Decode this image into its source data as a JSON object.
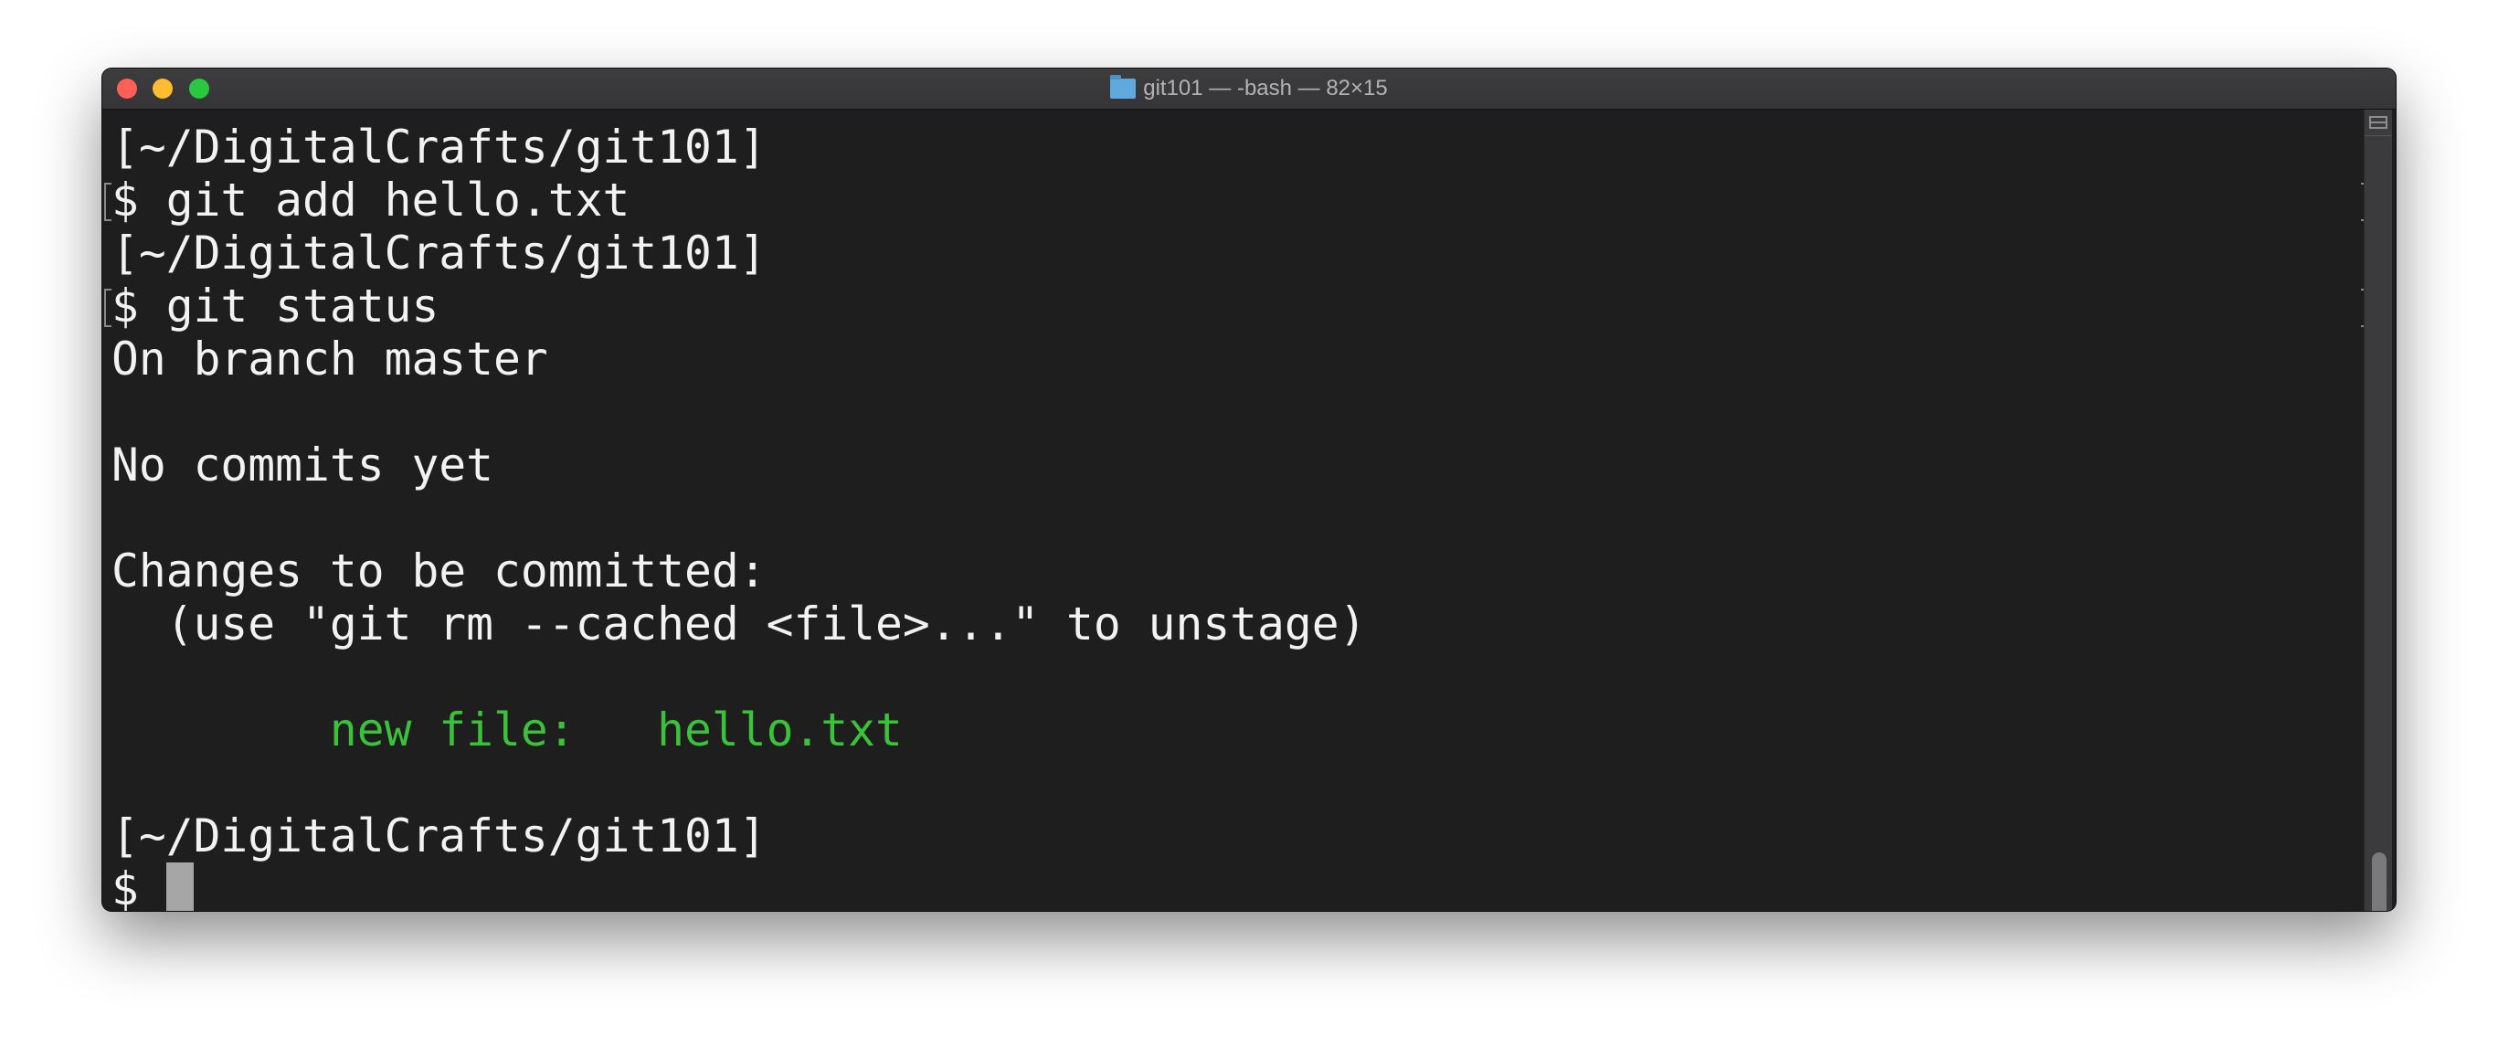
{
  "window": {
    "title": "git101 — -bash — 82×15",
    "title_icon": "folder-icon"
  },
  "terminal": {
    "lines": [
      {
        "text": "[~/DigitalCrafts/git101]"
      },
      {
        "text": "$ git add hello.txt"
      },
      {
        "text": "[~/DigitalCrafts/git101]"
      },
      {
        "text": "$ git status"
      },
      {
        "text": "On branch master"
      },
      {
        "text": ""
      },
      {
        "text": "No commits yet"
      },
      {
        "text": ""
      },
      {
        "text": "Changes to be committed:"
      },
      {
        "text": "  (use \"git rm --cached <file>...\" to unstage)"
      },
      {
        "text": ""
      },
      {
        "text": "        new file:   hello.txt"
      },
      {
        "text": ""
      },
      {
        "text": "[~/DigitalCrafts/git101]"
      },
      {
        "text": "$ "
      }
    ],
    "colors": {
      "foreground": "#f2f2f2",
      "background": "#1e1e1e",
      "staged": "#3cc13b"
    }
  }
}
